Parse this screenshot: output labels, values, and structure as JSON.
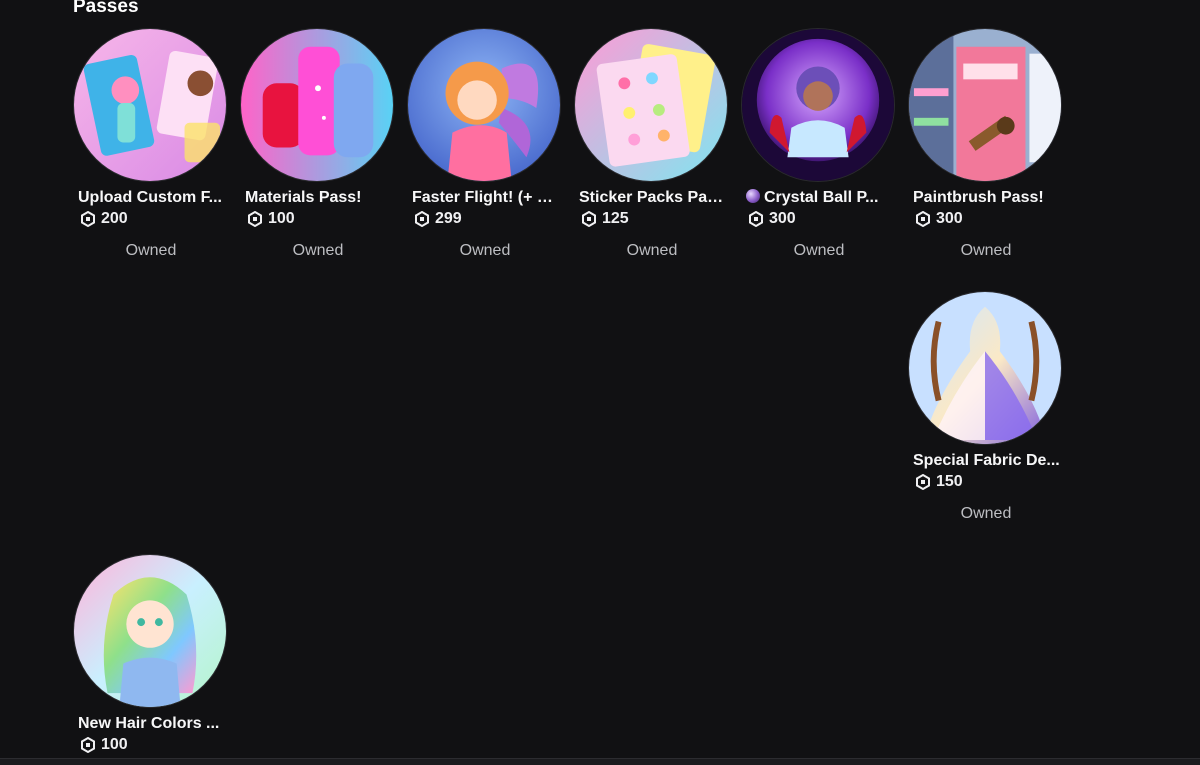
{
  "section": {
    "title": "Passes"
  },
  "passes": [
    {
      "name": "Upload Custom F...",
      "price": "200",
      "status": "Owned",
      "icon": "pass-thumbnail"
    },
    {
      "name": "Materials Pass!",
      "price": "100",
      "status": "Owned",
      "icon": "pass-thumbnail"
    },
    {
      "name": "Faster Flight! (+ C...",
      "price": "299",
      "status": "Owned",
      "icon": "pass-thumbnail"
    },
    {
      "name": "Sticker Packs Pass!",
      "price": "125",
      "status": "Owned",
      "icon": "pass-thumbnail"
    },
    {
      "name": "Crystal Ball P...",
      "price": "300",
      "status": "Owned",
      "icon": "pass-thumbnail"
    },
    {
      "name": "Paintbrush Pass!",
      "price": "300",
      "status": "Owned",
      "icon": "pass-thumbnail"
    },
    {
      "name": "Special Fabric De...",
      "price": "150",
      "status": "Owned",
      "icon": "pass-thumbnail"
    },
    {
      "name": "New Hair Colors ...",
      "price": "100",
      "status": "",
      "icon": "pass-thumbnail"
    }
  ],
  "icons": {
    "currency": "robux-icon"
  },
  "colors": {
    "background": "#111113",
    "text": "#ffffff",
    "status": "#bdbec2"
  }
}
